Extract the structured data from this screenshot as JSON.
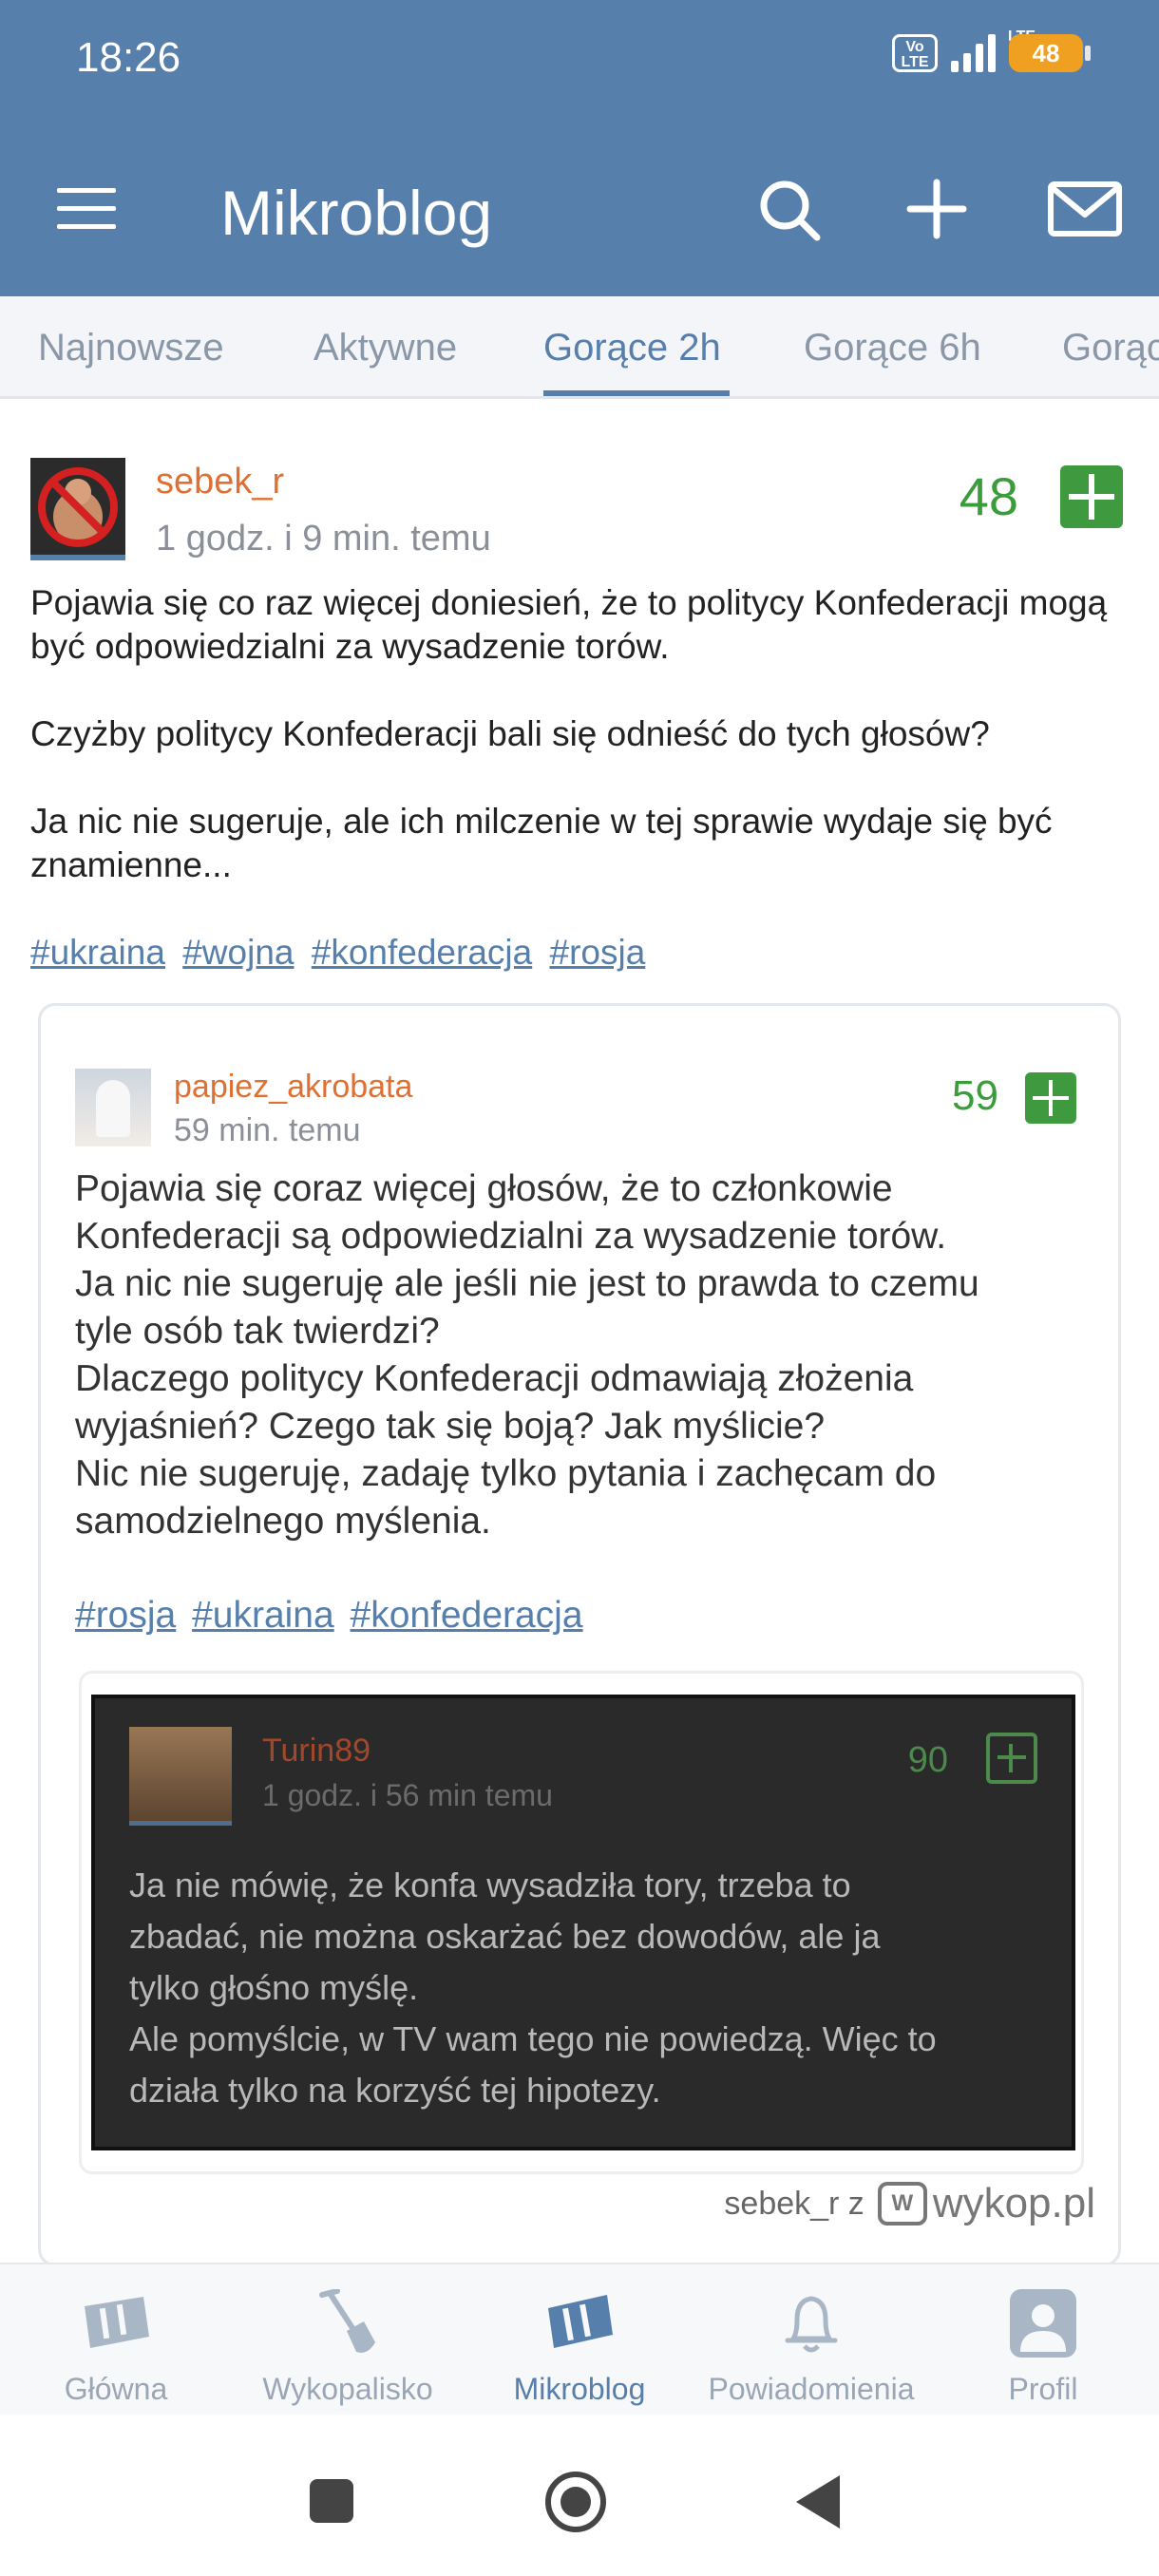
{
  "status_bar": {
    "time": "18:26",
    "network": "LTE",
    "volte": "Vo LTE",
    "battery": "48"
  },
  "app_bar": {
    "title": "Mikroblog",
    "icons": [
      "menu-icon",
      "search-icon",
      "add-icon",
      "mail-icon"
    ]
  },
  "tabs": [
    {
      "label": "Najnowsze",
      "active": false
    },
    {
      "label": "Aktywne",
      "active": false
    },
    {
      "label": "Gorące 2h",
      "active": true
    },
    {
      "label": "Gorące 6h",
      "active": false
    },
    {
      "label": "Gorąc",
      "active": false
    }
  ],
  "post": {
    "author": "sebek_r",
    "time": "1 godz. i 9 min. temu",
    "votes": "48",
    "paragraphs": [
      "Pojawia się co raz więcej doniesień, że to politycy Konfederacji mogą być odpowiedzialni za wysadzenie torów.",
      "Czyżby politycy Konfederacji bali się odnieść do tych głosów?",
      "Ja nic nie sugeruje, ale ich milczenie w tej sprawie wydaje się być znamienne..."
    ],
    "tags": [
      "#ukraina",
      "#wojna",
      "#konfederacja",
      "#rosja"
    ]
  },
  "embed": {
    "author": "papiez_akrobata",
    "time": "59 min. temu",
    "votes": "59",
    "lines": [
      "Pojawia się coraz więcej głosów, że to członkowie",
      "Konfederacji są odpowiedzialni za wysadzenie torów.",
      "Ja nic nie sugeruję ale jeśli nie jest to prawda to czemu",
      "tyle osób tak twierdzi?",
      "Dlaczego politycy Konfederacji odmawiają złożenia",
      "wyjaśnień? Czego tak się boją? Jak myślicie?",
      "Nic nie sugeruję, zadaję tylko pytania i zachęcam do",
      "samodzielnego myślenia."
    ],
    "tags": [
      "#rosja",
      "#ukraina",
      "#konfederacja"
    ],
    "inner": {
      "author": "Turin89",
      "time": "1 godz. i 56 min temu",
      "votes": "90",
      "lines": [
        "Ja nie mówię, że konfa wysadziła tory, trzeba to",
        "zbadać, nie można oskarżać bez dowodów, ale ja",
        "tylko głośno myślę.",
        "Ale pomyślcie, w TV wam tego nie powiedzą. Więc to",
        "działa tylko na korzyść tej hipotezy."
      ]
    },
    "watermark_user": "sebek_r  z",
    "watermark_logo": "wykop.pl",
    "watermark_box": "W"
  },
  "bottom_nav": [
    {
      "label": "Główna",
      "icon": "home-icon",
      "active": false
    },
    {
      "label": "Wykopalisko",
      "icon": "shovel-icon",
      "active": false
    },
    {
      "label": "Mikroblog",
      "icon": "mikroblog-icon",
      "active": true
    },
    {
      "label": "Powiadomienia",
      "icon": "bell-icon",
      "active": false
    },
    {
      "label": "Profil",
      "icon": "profile-icon",
      "active": false
    }
  ],
  "colors": {
    "brand": "#567fac",
    "author": "#e07032",
    "votes": "#3b9c3b"
  }
}
